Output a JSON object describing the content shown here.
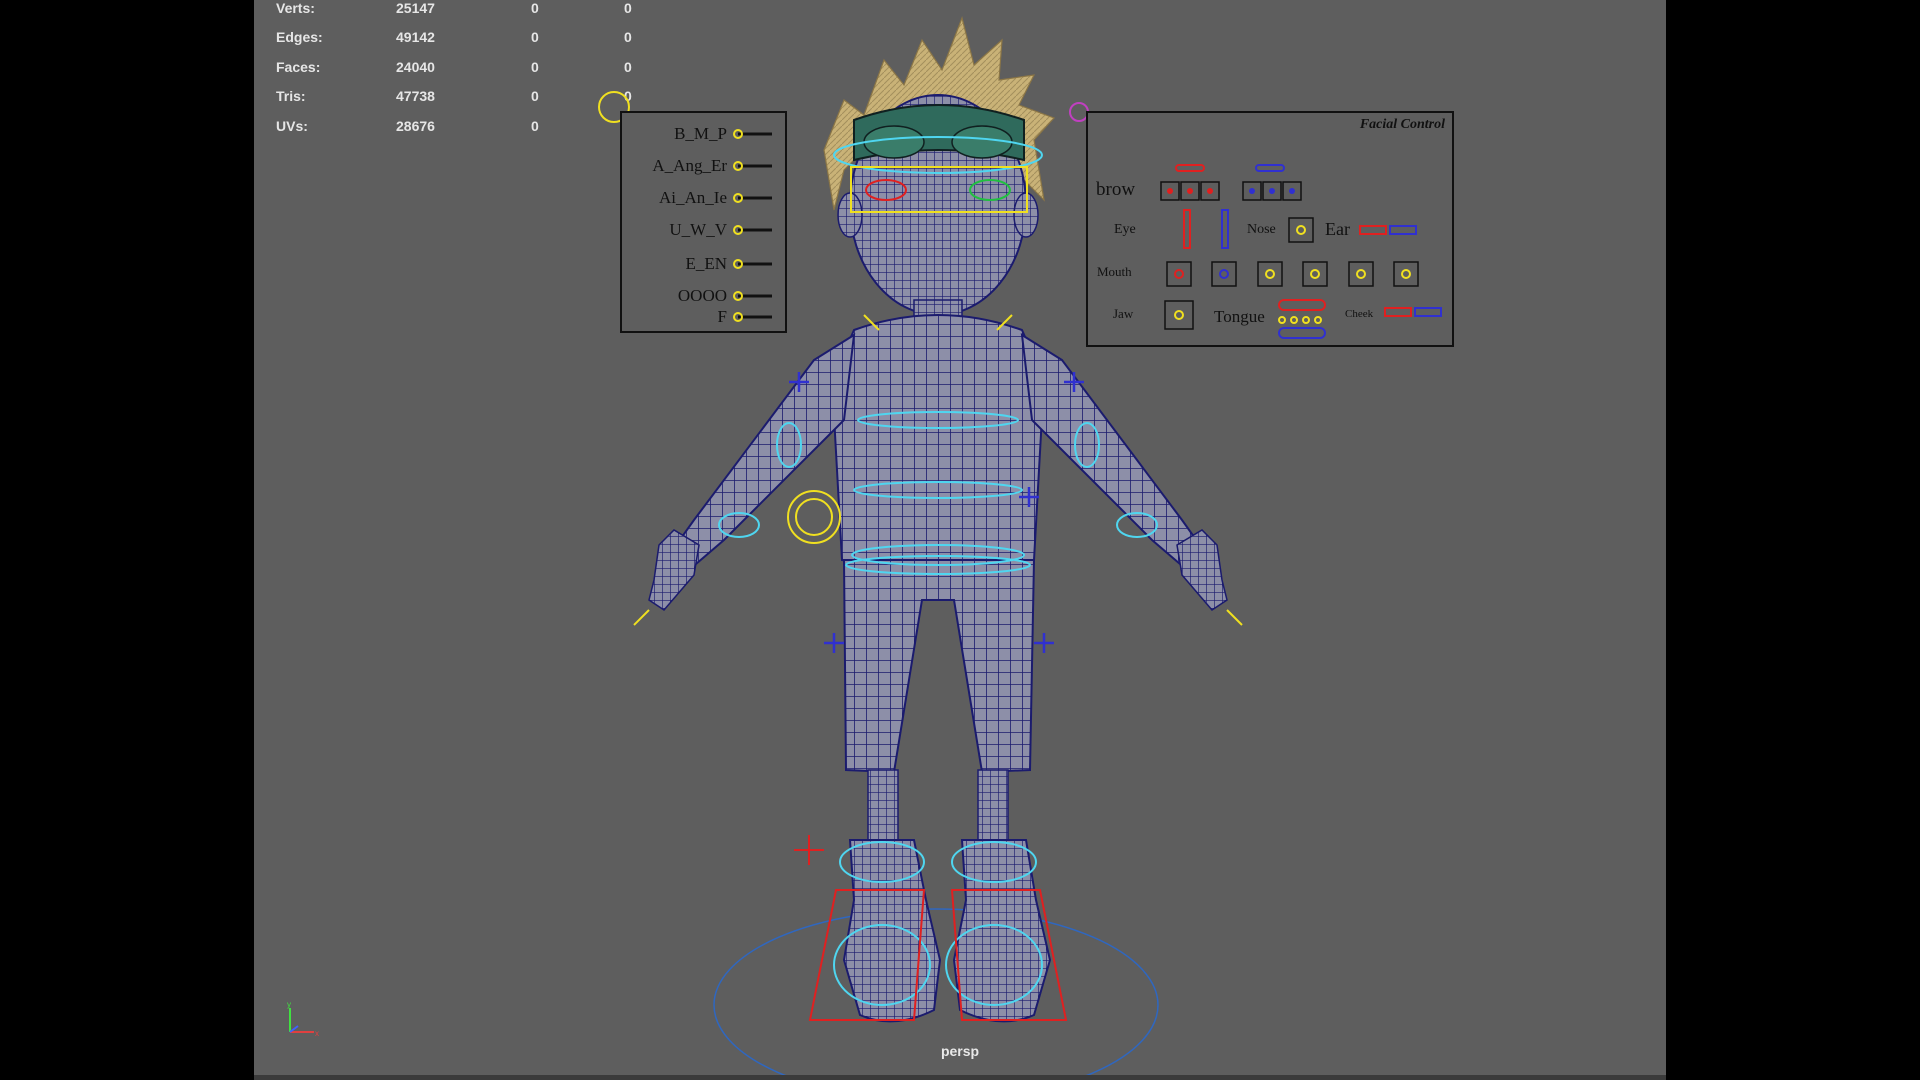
{
  "stats": [
    {
      "label": "Verts:",
      "value": "25147",
      "col1": "0",
      "col2": "0"
    },
    {
      "label": "Edges:",
      "value": "49142",
      "col1": "0",
      "col2": "0"
    },
    {
      "label": "Faces:",
      "value": "24040",
      "col1": "0",
      "col2": "0"
    },
    {
      "label": "Tris:",
      "value": "47738",
      "col1": "0",
      "col2": "0"
    },
    {
      "label": "UVs:",
      "value": "28676",
      "col1": "0",
      "col2": "0"
    }
  ],
  "phoneme_panel": {
    "sliders": [
      "B_M_P",
      "A_Ang_Er",
      "Ai_An_Ie",
      "U_W_V",
      "E_EN",
      "OOOO",
      "F"
    ]
  },
  "facial_panel": {
    "title": "Facial Control",
    "brow_label": "brow",
    "eye_label": "Eye",
    "nose_label": "Nose",
    "ear_label": "Ear",
    "mouth_label": "Mouth",
    "jaw_label": "Jaw",
    "tongue_label": "Tongue",
    "cheek_label": "Cheek"
  },
  "camera_label": "persp",
  "colors": {
    "viewport_bg": "#5e5e5e",
    "wire": "#1b1b6e",
    "control_cyan": "#4fd6f0",
    "control_yellow": "#f0e020",
    "control_red": "#e02020",
    "control_blue": "#3030d0",
    "hair": "#c9b277"
  }
}
